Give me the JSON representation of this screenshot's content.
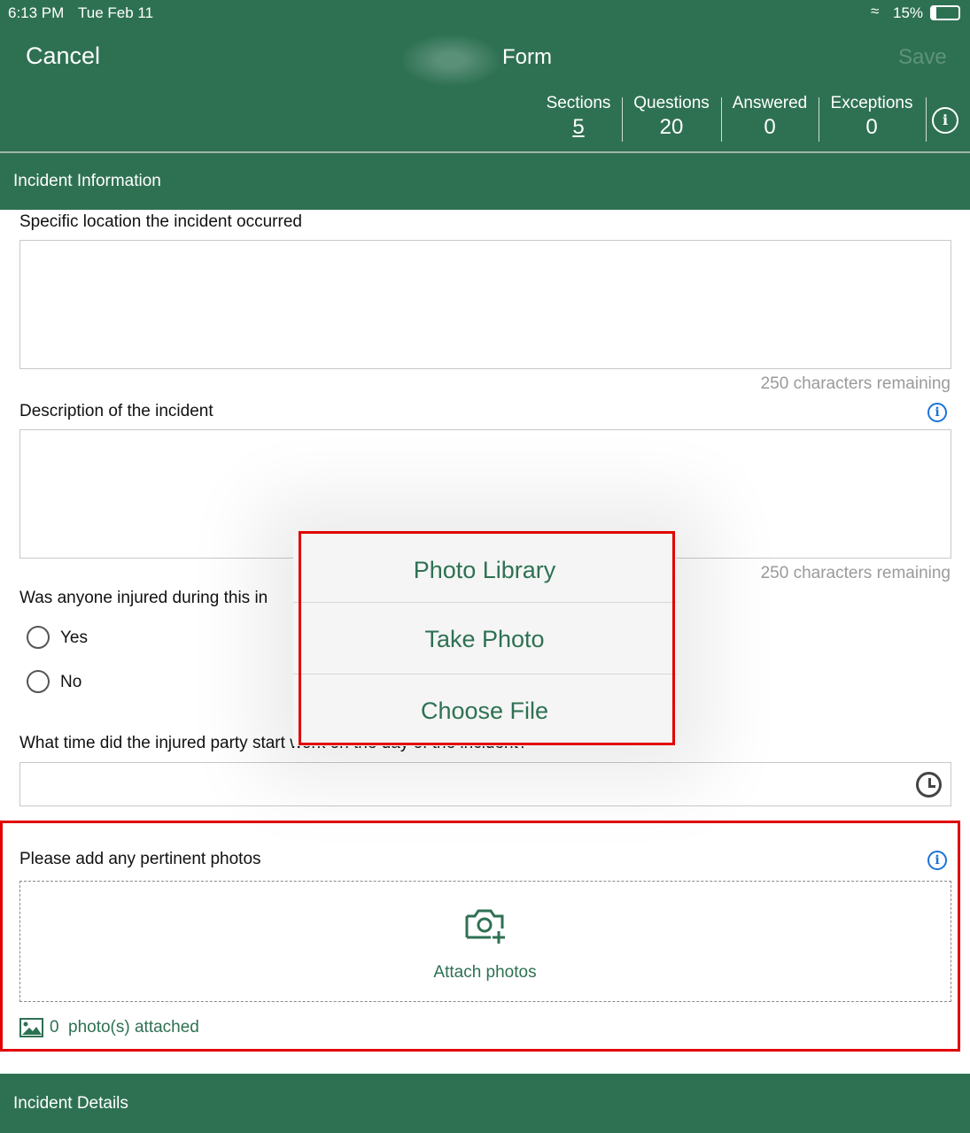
{
  "status_bar": {
    "time": "6:13 PM",
    "date": "Tue Feb 11",
    "battery": "15%"
  },
  "header": {
    "cancel": "Cancel",
    "title": "Form",
    "save": "Save",
    "stats": [
      {
        "label": "Sections",
        "value": "5"
      },
      {
        "label": "Questions",
        "value": "20"
      },
      {
        "label": "Answered",
        "value": "0"
      },
      {
        "label": "Exceptions",
        "value": "0"
      }
    ]
  },
  "section1": "Incident Information",
  "q1": {
    "label": "Specific location the incident occurred",
    "remaining": "250 characters remaining"
  },
  "q2": {
    "label": "Description of the incident",
    "remaining": "250 characters remaining"
  },
  "q3": {
    "label": "Was anyone injured during this in",
    "options": [
      "Yes",
      "No"
    ]
  },
  "q4": {
    "label": "What time did the injured party start work on the day of the incident?"
  },
  "q5": {
    "label": "Please add any pertinent photos",
    "attach": "Attach photos",
    "count": "0",
    "attached": "photo(s) attached"
  },
  "section2": "Incident Details",
  "popover": {
    "items": [
      "Photo Library",
      "Take Photo",
      "Choose File"
    ]
  },
  "colors": {
    "brand": "#2e7152",
    "annotation": "#e00000",
    "info": "#1a73d9"
  }
}
